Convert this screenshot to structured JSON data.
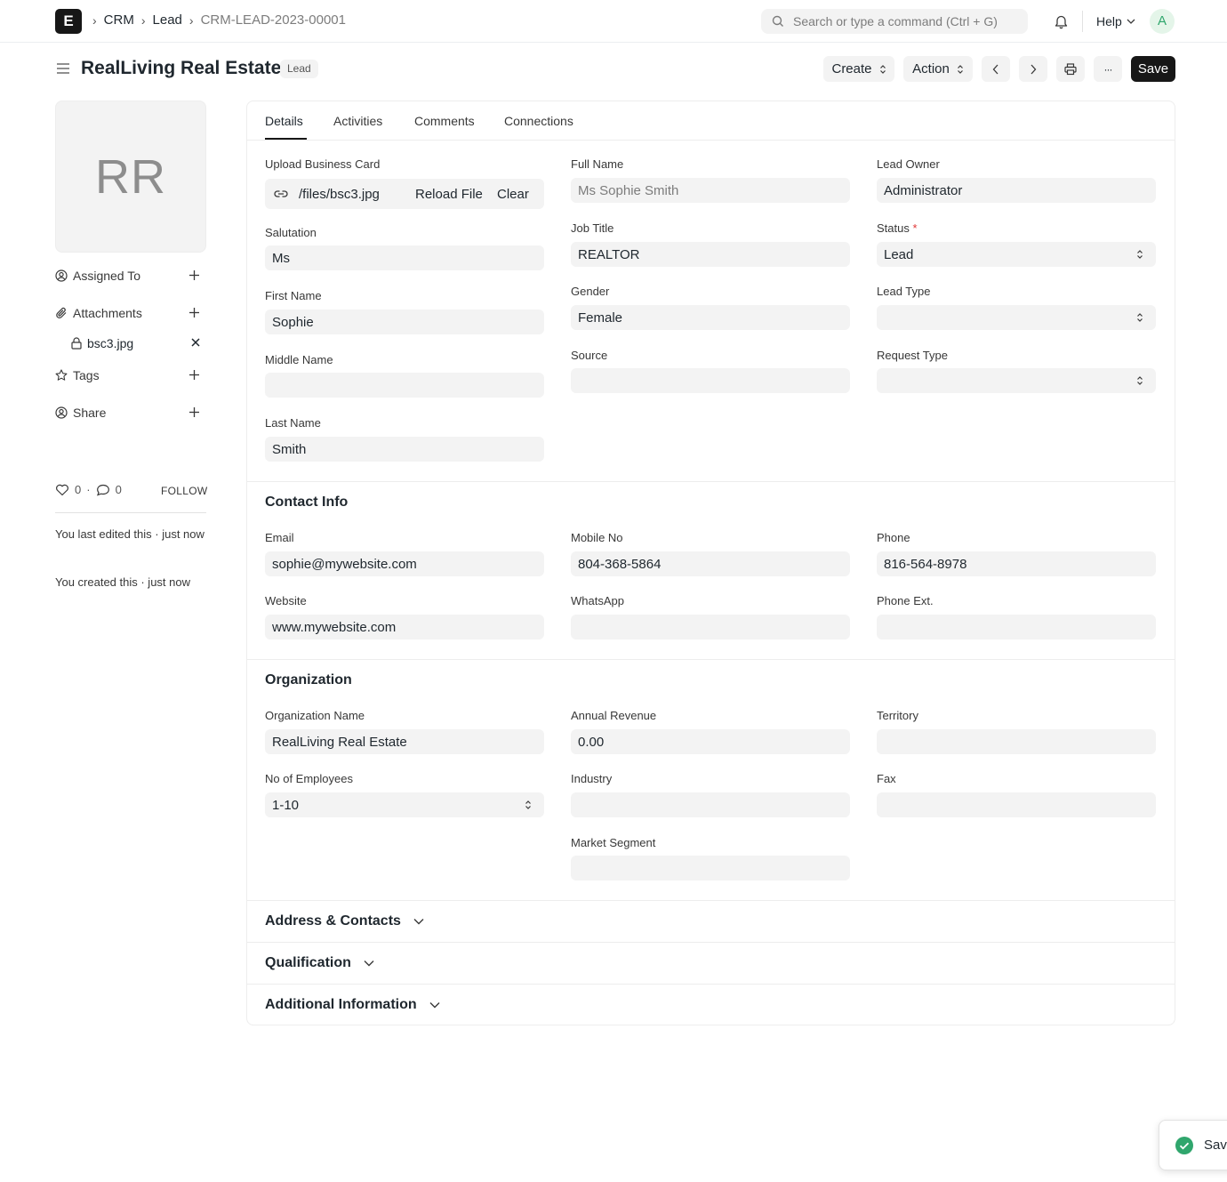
{
  "topbar": {
    "logo_letter": "E",
    "breadcrumbs": [
      "CRM",
      "Lead",
      "CRM-LEAD-2023-00001"
    ],
    "search_placeholder": "Search or type a command (Ctrl + G)",
    "help_label": "Help",
    "user_initial": "A"
  },
  "header": {
    "title": "RealLiving Real Estate",
    "status_badge": "Lead",
    "create_label": "Create",
    "action_label": "Action",
    "more_label": "···",
    "save_label": "Save"
  },
  "sidebar": {
    "avatar_initials": "RR",
    "assigned_to": "Assigned To",
    "attachments": "Attachments",
    "attachment_file": "bsc3.jpg",
    "tags": "Tags",
    "share": "Share",
    "like_count": "0",
    "comment_count": "0",
    "follow_label": "FOLLOW",
    "activity_1": "You last edited this · just now",
    "activity_2": "You created this · just now"
  },
  "tabs": [
    "Details",
    "Activities",
    "Comments",
    "Connections"
  ],
  "details": {
    "upload_business_card": {
      "label": "Upload Business Card",
      "value": "/files/bsc3.jpg",
      "reload": "Reload File",
      "clear": "Clear"
    },
    "salutation": {
      "label": "Salutation",
      "value": "Ms"
    },
    "first_name": {
      "label": "First Name",
      "value": "Sophie"
    },
    "middle_name": {
      "label": "Middle Name",
      "value": ""
    },
    "last_name": {
      "label": "Last Name",
      "value": "Smith"
    },
    "full_name": {
      "label": "Full Name",
      "value": "Ms Sophie Smith"
    },
    "job_title": {
      "label": "Job Title",
      "value": "REALTOR"
    },
    "gender": {
      "label": "Gender",
      "value": "Female"
    },
    "source": {
      "label": "Source",
      "value": ""
    },
    "lead_owner": {
      "label": "Lead Owner",
      "value": "Administrator"
    },
    "status": {
      "label": "Status",
      "required": "*",
      "value": "Lead"
    },
    "lead_type": {
      "label": "Lead Type",
      "value": ""
    },
    "request_type": {
      "label": "Request Type",
      "value": ""
    }
  },
  "contact_info": {
    "heading": "Contact Info",
    "email": {
      "label": "Email",
      "value": "sophie@mywebsite.com"
    },
    "website": {
      "label": "Website",
      "value": "www.mywebsite.com"
    },
    "mobile_no": {
      "label": "Mobile No",
      "value": "804-368-5864"
    },
    "whatsapp": {
      "label": "WhatsApp",
      "value": ""
    },
    "phone": {
      "label": "Phone",
      "value": "816-564-8978"
    },
    "phone_ext": {
      "label": "Phone Ext.",
      "value": ""
    }
  },
  "organization": {
    "heading": "Organization",
    "org_name": {
      "label": "Organization Name",
      "value": "RealLiving Real Estate"
    },
    "no_of_employees": {
      "label": "No of Employees",
      "value": "1-10"
    },
    "annual_revenue": {
      "label": "Annual Revenue",
      "value": "0.00"
    },
    "industry": {
      "label": "Industry",
      "value": ""
    },
    "market_segment": {
      "label": "Market Segment",
      "value": ""
    },
    "territory": {
      "label": "Territory",
      "value": ""
    },
    "fax": {
      "label": "Fax",
      "value": ""
    }
  },
  "collapsed_sections": [
    "Address & Contacts",
    "Qualification",
    "Additional Information"
  ],
  "toast": {
    "text": "Save"
  }
}
